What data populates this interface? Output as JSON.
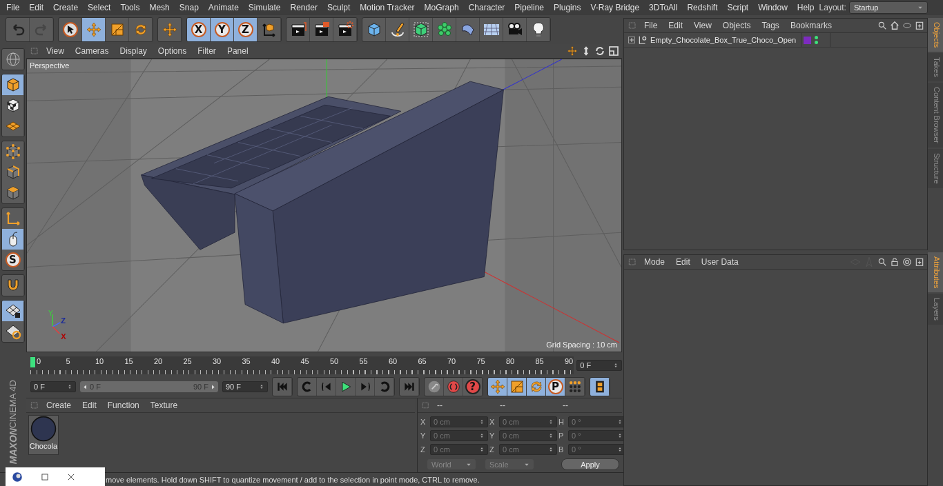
{
  "menu_bar": {
    "items": [
      "File",
      "Edit",
      "Create",
      "Select",
      "Tools",
      "Mesh",
      "Snap",
      "Animate",
      "Simulate",
      "Render",
      "Sculpt",
      "Motion Tracker",
      "MoGraph",
      "Character",
      "Pipeline",
      "Plugins",
      "V-Ray Bridge",
      "3DToAll",
      "Redshift",
      "Script",
      "Window",
      "Help"
    ],
    "layout_label": "Layout:",
    "layout_value": "Startup"
  },
  "toolbar": {
    "groups": [
      {
        "items": [
          {
            "kind": "undo",
            "selected": false,
            "disabled": false
          },
          {
            "kind": "redo",
            "selected": false,
            "disabled": true
          }
        ]
      },
      {
        "items": [
          {
            "kind": "select",
            "selected": false,
            "disabled": false
          },
          {
            "kind": "move",
            "selected": true,
            "disabled": false
          },
          {
            "kind": "scale",
            "selected": false,
            "disabled": false
          },
          {
            "kind": "rotate",
            "selected": false,
            "disabled": false
          }
        ]
      },
      {
        "items": [
          {
            "kind": "move",
            "selected": false,
            "disabled": false
          }
        ]
      },
      {
        "items": [
          {
            "kind": "axis",
            "label": "X",
            "selected": true,
            "disabled": false
          },
          {
            "kind": "axis",
            "label": "Y",
            "selected": true,
            "disabled": false
          },
          {
            "kind": "axis",
            "label": "Z",
            "selected": true,
            "disabled": false
          },
          {
            "kind": "coord",
            "selected": false,
            "disabled": false
          }
        ]
      },
      {
        "items": [
          {
            "kind": "render-view",
            "selected": false,
            "disabled": false
          },
          {
            "kind": "render-picture",
            "selected": false,
            "disabled": false
          },
          {
            "kind": "render-settings",
            "selected": false,
            "disabled": false
          }
        ]
      },
      {
        "items": [
          {
            "kind": "cube",
            "selected": false,
            "disabled": false
          },
          {
            "kind": "pen",
            "selected": false,
            "disabled": false
          },
          {
            "kind": "subdivision",
            "selected": false,
            "disabled": false
          },
          {
            "kind": "cloner",
            "selected": false,
            "disabled": false
          },
          {
            "kind": "deformer",
            "selected": false,
            "disabled": false
          },
          {
            "kind": "floor",
            "selected": false,
            "disabled": false
          },
          {
            "kind": "camera",
            "selected": false,
            "disabled": false
          },
          {
            "kind": "light",
            "selected": false,
            "disabled": false
          }
        ]
      }
    ]
  },
  "left_tools": {
    "groups": [
      {
        "items": [
          {
            "kind": "globe",
            "selected": false
          }
        ]
      },
      {
        "items": [
          {
            "kind": "model",
            "selected": true
          },
          {
            "kind": "texture",
            "selected": false
          },
          {
            "kind": "workplane",
            "selected": false
          }
        ]
      },
      {
        "items": [
          {
            "kind": "points",
            "selected": false
          },
          {
            "kind": "edges",
            "selected": false
          },
          {
            "kind": "polygons",
            "selected": false
          }
        ]
      },
      {
        "items": [
          {
            "kind": "axis-mode",
            "selected": false
          },
          {
            "kind": "mouse",
            "selected": true
          },
          {
            "kind": "letter",
            "label": "S",
            "selected": false
          }
        ]
      },
      {
        "items": [
          {
            "kind": "magnet",
            "selected": false
          }
        ]
      },
      {
        "items": [
          {
            "kind": "grid-lock",
            "selected": true
          },
          {
            "kind": "grid-sync",
            "selected": false
          }
        ]
      }
    ]
  },
  "logo": {
    "brand": "MAXON",
    "product": "CINEMA 4D"
  },
  "viewport": {
    "menu": [
      "View",
      "Cameras",
      "Display",
      "Options",
      "Filter",
      "Panel"
    ],
    "camera": "Perspective",
    "grid_info": "Grid Spacing : 10 cm",
    "gizmo": [
      "Y",
      "Z",
      "X"
    ]
  },
  "timeline": {
    "ticks": [
      "0",
      "5",
      "10",
      "15",
      "20",
      "25",
      "30",
      "35",
      "40",
      "45",
      "50",
      "55",
      "60",
      "65",
      "70",
      "75",
      "80",
      "85",
      "90"
    ],
    "level": 0,
    "frame_field": "0 F"
  },
  "transport": {
    "start_field": "0 F",
    "range": {
      "start": "0 F",
      "end": "90 F",
      "level": 1
    },
    "end_field": "90 F",
    "groups": [
      {
        "items": [
          {
            "kind": "first",
            "selected": false
          }
        ]
      },
      {
        "items": [
          {
            "kind": "prev-key",
            "selected": false
          },
          {
            "kind": "prev-frame",
            "selected": false
          },
          {
            "kind": "play",
            "selected": false
          },
          {
            "kind": "next-frame",
            "selected": false
          },
          {
            "kind": "next-key",
            "selected": false
          }
        ]
      },
      {
        "items": [
          {
            "kind": "last",
            "selected": false
          }
        ]
      },
      {
        "items": [
          {
            "kind": "key",
            "selected": false
          },
          {
            "kind": "record",
            "selected": false
          },
          {
            "kind": "help",
            "label": "?",
            "selected": false
          }
        ]
      },
      {
        "items": [
          {
            "kind": "move",
            "selected": true
          },
          {
            "kind": "scale",
            "selected": true
          },
          {
            "kind": "rotate",
            "selected": true
          },
          {
            "kind": "param",
            "label": "P",
            "selected": true
          },
          {
            "kind": "dots",
            "selected": false
          }
        ]
      },
      {
        "items": [
          {
            "kind": "film",
            "selected": true
          }
        ]
      }
    ]
  },
  "materials": {
    "menu": [
      "Create",
      "Edit",
      "Function",
      "Texture"
    ],
    "items": [
      {
        "name": "Chocola"
      }
    ]
  },
  "coordinates": {
    "headers": [
      "--",
      "--",
      "--"
    ],
    "rows": [
      {
        "labels": [
          "X",
          "X",
          "H"
        ],
        "values": [
          "0 cm",
          "0 cm",
          "0 °"
        ]
      },
      {
        "labels": [
          "Y",
          "Y",
          "P"
        ],
        "values": [
          "0 cm",
          "0 cm",
          "0 °"
        ]
      },
      {
        "labels": [
          "Z",
          "Z",
          "B"
        ],
        "values": [
          "0 cm",
          "0 cm",
          "0 °"
        ]
      }
    ],
    "dropdowns": [
      "World",
      "Scale"
    ],
    "apply": "Apply"
  },
  "status": "move elements. Hold down SHIFT to quantize movement / add to the selection in point mode, CTRL to remove.",
  "objects": {
    "menu": [
      "File",
      "Edit",
      "View",
      "Objects",
      "Tags",
      "Bookmarks"
    ],
    "rows": [
      {
        "name": "Empty_Chocolate_Box_True_Choco_Open",
        "expanded": false,
        "color": "#7d2bbf",
        "visible": true
      }
    ]
  },
  "attributes": {
    "menu": [
      "Mode",
      "Edit",
      "User Data"
    ]
  },
  "side_tabs_top": [
    {
      "label": "Objects",
      "selected": true
    },
    {
      "label": "Takes",
      "selected": false
    },
    {
      "label": "Content Browser",
      "selected": false
    },
    {
      "label": "Structure",
      "selected": false
    }
  ],
  "side_tabs_bottom": [
    {
      "label": "Attributes",
      "selected": true
    },
    {
      "label": "Layers",
      "selected": false
    }
  ]
}
